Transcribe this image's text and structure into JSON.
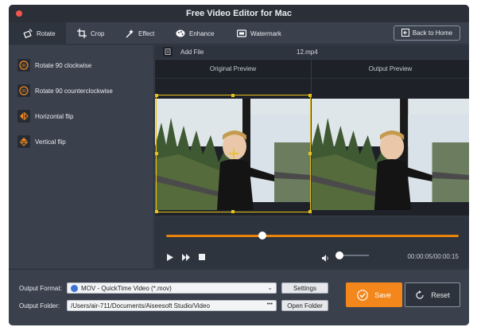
{
  "window": {
    "title": "Free Video Editor for Mac"
  },
  "toolbar": {
    "tabs": [
      {
        "label": "Rotate",
        "icon": "rotate-icon"
      },
      {
        "label": "Crop",
        "icon": "crop-icon"
      },
      {
        "label": "Effect",
        "icon": "effect-icon"
      },
      {
        "label": "Enhance",
        "icon": "enhance-icon"
      },
      {
        "label": "Watermark",
        "icon": "watermark-icon"
      }
    ],
    "back_label": "Back to Home"
  },
  "sidebar": {
    "items": [
      {
        "label": "Rotate 90 clockwise",
        "icon": "rotate-cw-icon",
        "glyph": "90"
      },
      {
        "label": "Rotate 90 counterclockwise",
        "icon": "rotate-ccw-icon",
        "glyph": "90"
      },
      {
        "label": "Horizontal flip",
        "icon": "horizontal-flip-icon"
      },
      {
        "label": "Vertical flip",
        "icon": "vertical-flip-icon"
      }
    ]
  },
  "file_bar": {
    "add_label": "Add File",
    "filename": "12.mp4"
  },
  "preview": {
    "original_label": "Original Preview",
    "output_label": "Output Preview"
  },
  "player": {
    "progress": 0.33,
    "volume": 0.1,
    "time": "00:00:05/00:00:15"
  },
  "output": {
    "format_label": "Output Format:",
    "format_value": "MOV - QuickTime Video (*.mov)",
    "settings_label": "Settings",
    "folder_label": "Output Folder:",
    "folder_value": "/Users/air-711/Documents/Aiseesoft Studio/Video",
    "open_folder_label": "Open Folder",
    "folder_dots": "•••"
  },
  "actions": {
    "save_label": "Save",
    "reset_label": "Reset"
  },
  "colors": {
    "accent": "#f3871c",
    "crop_frame": "#e8c21a",
    "window_bg": "#343c48"
  }
}
